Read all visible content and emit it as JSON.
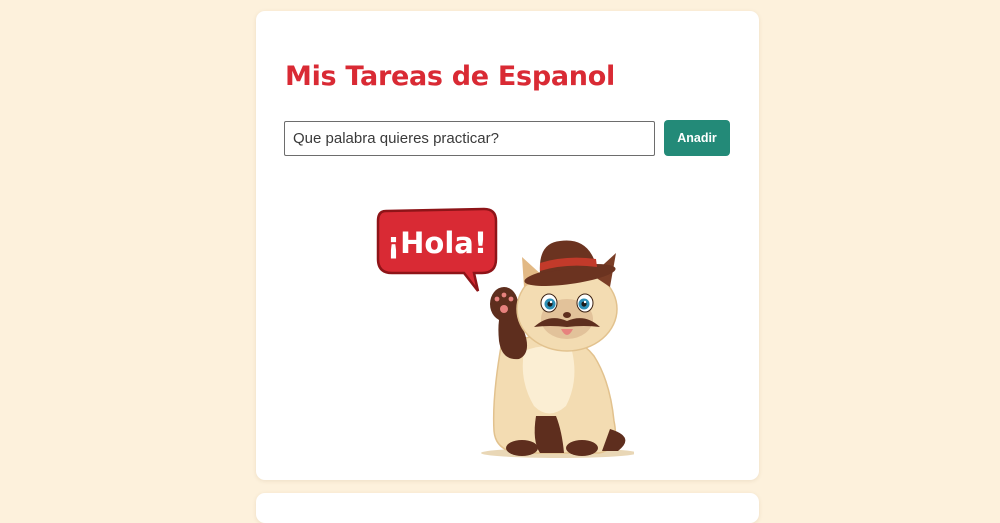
{
  "task_card": {
    "title": "Mis Tareas de Espanol",
    "input": {
      "placeholder": "Que palabra quieres practicar?",
      "value": ""
    },
    "add_label": "Anadir",
    "mascot": {
      "speech": "¡Hola!",
      "icon": "waving-cat-with-hat-icon"
    }
  },
  "colors": {
    "page_bg": "#fdf1dc",
    "title": "#d92a34",
    "button": "#238a78",
    "speech_bubble": "#d92a34"
  }
}
